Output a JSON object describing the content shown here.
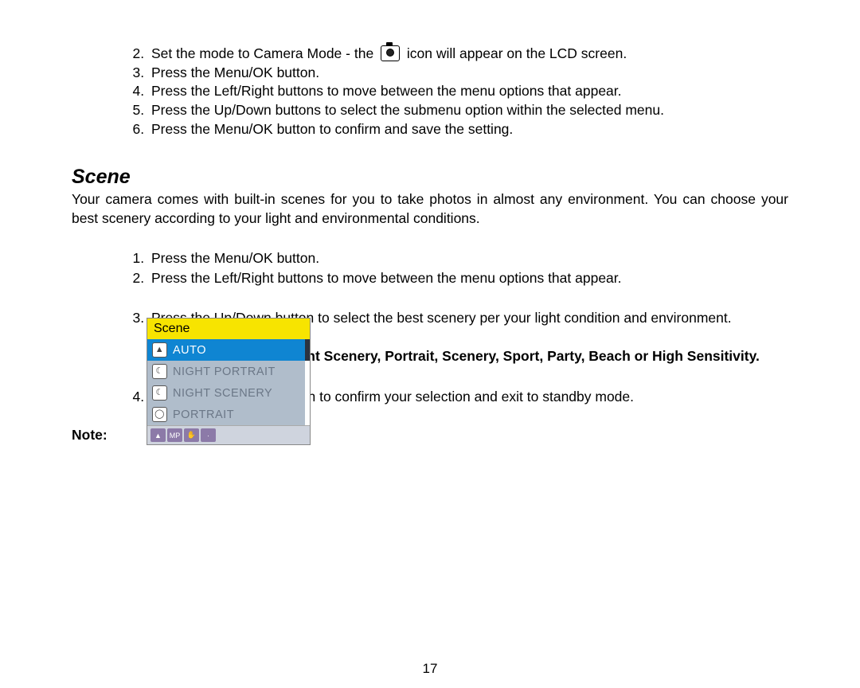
{
  "steps_top": [
    {
      "n": "2",
      "before": "Set the mode to Camera Mode - the",
      "after": "icon will appear on the LCD screen."
    },
    {
      "n": "3",
      "text": "Press the Menu/OK button."
    },
    {
      "n": "4",
      "text": "Press the Left/Right buttons to move between the menu options that appear."
    },
    {
      "n": "5",
      "text": "Press the Up/Down buttons to select the submenu option within the selected menu."
    },
    {
      "n": "6",
      "text": "Press the Menu/OK button to confirm and save the setting."
    }
  ],
  "section_title": "Scene",
  "intro_para": "Your camera comes with built-in scenes for you to take photos in almost any environment. You can choose your best scenery according to your light and environmental conditions.",
  "steps_bottom_a": [
    {
      "n": "1",
      "text": "Press the Menu/OK button."
    },
    {
      "n": "2",
      "text": "Press the Left/Right buttons to move between the menu options that appear."
    }
  ],
  "steps_bottom_b": [
    {
      "n": "3",
      "text": "Press the Up/Down button to select the best scenery per your light condition and environment."
    }
  ],
  "options_line": "Auto, Night Portrait, Night Scenery, Portrait, Scenery, Sport, Party, Beach or High Sensitivity.",
  "steps_bottom_c": [
    {
      "n": "4",
      "text": "Press the Menu/OK button to confirm your selection and exit to standby mode."
    }
  ],
  "note_label": "Note:",
  "page_number": "17",
  "menu": {
    "header": "Scene",
    "items": [
      {
        "label": "AUTO",
        "selected": true
      },
      {
        "label": "NIGHT PORTRAIT",
        "selected": false
      },
      {
        "label": "NIGHT SCENERY",
        "selected": false
      },
      {
        "label": "PORTRAIT",
        "selected": false
      }
    ],
    "bottom_badges": [
      "",
      "MP",
      "",
      ""
    ]
  }
}
